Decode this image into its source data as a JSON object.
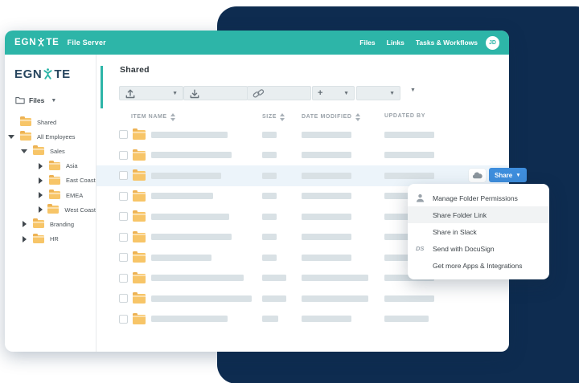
{
  "colors": {
    "teal": "#2db5a8",
    "navy": "#0e2c50",
    "blue": "#3e8edd",
    "folder": "#f7c568",
    "foldertab": "#edb254",
    "bar": "#d9e1e5",
    "rowhl": "#ecf4fa",
    "menuhl": "#f1f3f4"
  },
  "topbar": {
    "brand_pre": "EGN",
    "brand_post": "TE",
    "product": "File Server",
    "nav": [
      "Files",
      "Links",
      "Tasks & Workflows"
    ],
    "avatar_initials": "JD"
  },
  "sidebar": {
    "brand_pre": "EGN",
    "brand_post": "TE",
    "files_label": "Files",
    "tree": [
      {
        "label": "Shared",
        "level": 0,
        "arrow": "none"
      },
      {
        "label": "All Employees",
        "level": 0,
        "arrow": "expanded"
      },
      {
        "label": "Sales",
        "level": 1,
        "arrow": "expanded"
      },
      {
        "label": "Asia",
        "level": 2,
        "arrow": "collapsed"
      },
      {
        "label": "East Coast",
        "level": 2,
        "arrow": "collapsed"
      },
      {
        "label": "EMEA",
        "level": 2,
        "arrow": "collapsed"
      },
      {
        "label": "West Coast",
        "level": 2,
        "arrow": "collapsed"
      },
      {
        "label": "Branding",
        "level": 1,
        "arrow": "collapsed"
      },
      {
        "label": "HR",
        "level": 1,
        "arrow": "collapsed"
      }
    ]
  },
  "main": {
    "heading": "Shared",
    "toolbar": {
      "buttons": [
        {
          "icon": "upload-icon",
          "caret": true
        },
        {
          "icon": "download-icon",
          "caret": false
        },
        {
          "icon": "link-icon",
          "caret": false
        },
        {
          "icon": "plus-icon",
          "caret": true
        },
        {
          "icon": "",
          "caret": true
        }
      ],
      "more": {
        "icon": "hamburger-icon",
        "caret": true
      }
    },
    "table": {
      "headers": [
        {
          "label": "ITEM NAME",
          "sortable": true
        },
        {
          "label": "SIZE",
          "sortable": true
        },
        {
          "label": "DATE MODIFIED",
          "sortable": true
        },
        {
          "label": "UPDATED BY",
          "sortable": false
        }
      ],
      "rows": [
        {
          "icon": "folder-icon",
          "name_w": 95,
          "size_w": 18,
          "date_w": 62,
          "upd_w": 62,
          "highlighted": false
        },
        {
          "icon": "folder-icon",
          "name_w": 100,
          "size_w": 18,
          "date_w": 62,
          "upd_w": 62,
          "highlighted": false
        },
        {
          "icon": "folder-icon",
          "name_w": 87,
          "size_w": 18,
          "date_w": 62,
          "upd_w": 62,
          "highlighted": true
        },
        {
          "icon": "folder-icon",
          "name_w": 77,
          "size_w": 18,
          "date_w": 62,
          "upd_w": 62,
          "highlighted": false
        },
        {
          "icon": "folder-icon",
          "name_w": 97,
          "size_w": 18,
          "date_w": 62,
          "upd_w": 62,
          "highlighted": false
        },
        {
          "icon": "folder-icon",
          "name_w": 100,
          "size_w": 18,
          "date_w": 62,
          "upd_w": 62,
          "highlighted": false
        },
        {
          "icon": "folder-icon",
          "name_w": 75,
          "size_w": 18,
          "date_w": 62,
          "upd_w": 62,
          "highlighted": false
        },
        {
          "icon": "folder-icon",
          "name_w": 115,
          "size_w": 30,
          "date_w": 83,
          "upd_w": 62,
          "highlighted": false
        },
        {
          "icon": "folder-icon",
          "name_w": 125,
          "size_w": 30,
          "date_w": 83,
          "upd_w": 62,
          "highlighted": false
        },
        {
          "icon": "folder-icon",
          "name_w": 95,
          "size_w": 20,
          "date_w": 62,
          "upd_w": 55,
          "highlighted": false
        }
      ]
    },
    "share": {
      "label": "Share",
      "cloud_icon": "cloud-upload-icon"
    }
  },
  "context_menu": {
    "items": [
      {
        "icon": "user-icon",
        "label": "Manage Folder Permissions",
        "highlighted": false
      },
      {
        "icon": "",
        "label": "Share Folder Link",
        "highlighted": true
      },
      {
        "icon": "",
        "label": "Share in Slack",
        "highlighted": false
      },
      {
        "icon": "docusign-icon",
        "label": "Send with DocuSign",
        "highlighted": false
      },
      {
        "icon": "",
        "label": "Get more Apps & Integrations",
        "highlighted": false
      }
    ]
  }
}
